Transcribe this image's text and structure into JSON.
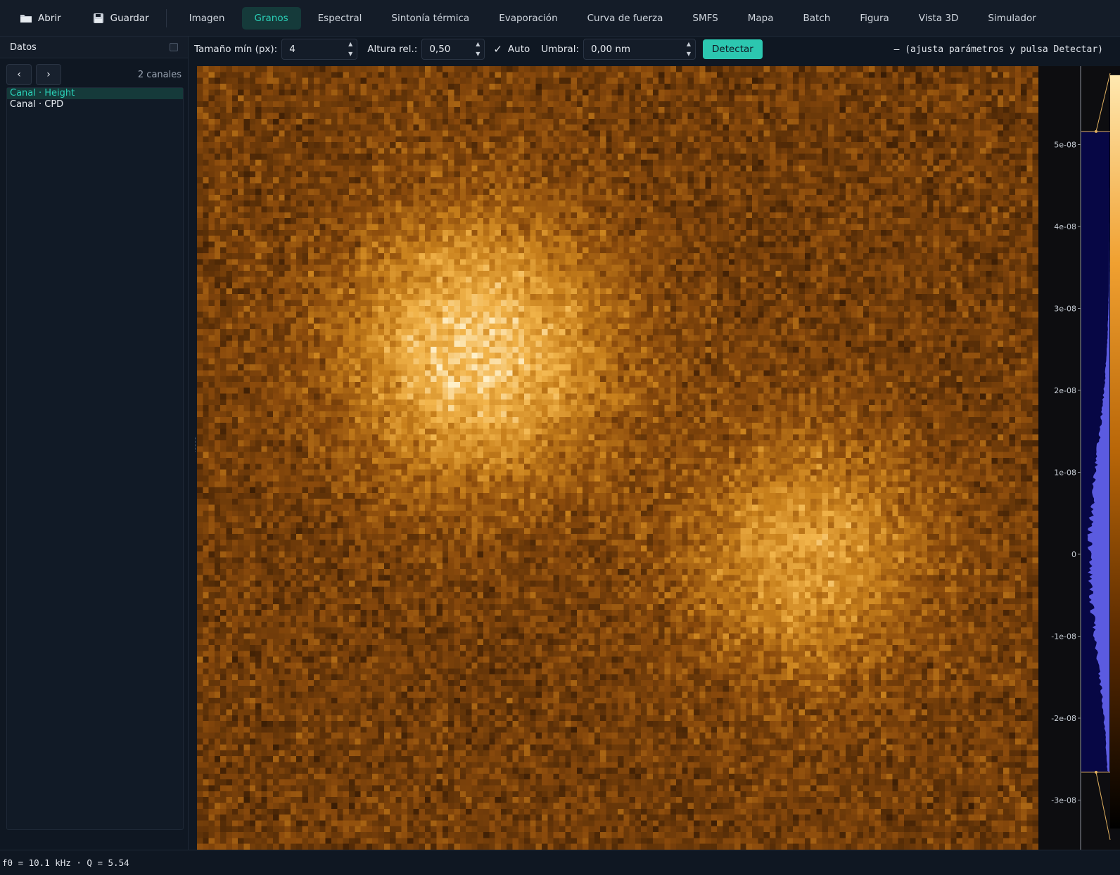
{
  "toolbar": {
    "open_label": "Abrir",
    "save_label": "Guardar",
    "tabs": [
      "Imagen",
      "Granos",
      "Espectral",
      "Sintonía térmica",
      "Evaporación",
      "Curva de fuerza",
      "SMFS",
      "Mapa",
      "Batch",
      "Figura",
      "Vista 3D",
      "Simulador"
    ],
    "active_tab": "Granos"
  },
  "sidebar": {
    "title": "Datos",
    "prev_label": "‹",
    "next_label": "›",
    "count_label": "2 canales",
    "items": [
      {
        "label": "Canal · Height",
        "selected": true
      },
      {
        "label": "Canal · CPD",
        "selected": false
      }
    ]
  },
  "params": {
    "min_size_label": "Tamaño mín (px):",
    "min_size_value": "4",
    "rel_height_label": "Altura rel.:",
    "rel_height_value": "0,50",
    "auto_label": "Auto",
    "auto_checked": true,
    "threshold_label": "Umbral:",
    "threshold_value": "0,00 nm",
    "detect_label": "Detectar",
    "hint": "— (ajusta parámetros y pulsa Detectar)"
  },
  "colorbar": {
    "tick_labels": [
      "5e-08",
      "4e-08",
      "3e-08",
      "2e-08",
      "1e-08",
      "0",
      "-1e-08",
      "-2e-08",
      "-3e-08"
    ],
    "tick_values": [
      5e-08,
      4e-08,
      3e-08,
      2e-08,
      1e-08,
      0,
      -1e-08,
      -2e-08,
      -3e-08
    ],
    "level_max": 5.16e-08,
    "level_min": -2.66e-08,
    "histogram_color": "#5b5be0",
    "colormap": [
      "#000000",
      "#5a2a00",
      "#b86608",
      "#f0a030",
      "#ffe8b0"
    ]
  },
  "image": {
    "colormap": [
      "#1a0a00",
      "#4a2606",
      "#8a4a0c",
      "#c8801c",
      "#f2b44a",
      "#fff0c8"
    ],
    "accent_color": "#2ad1b8"
  },
  "statusbar": {
    "text": "f0 = 10.1 kHz · Q = 5.54"
  }
}
